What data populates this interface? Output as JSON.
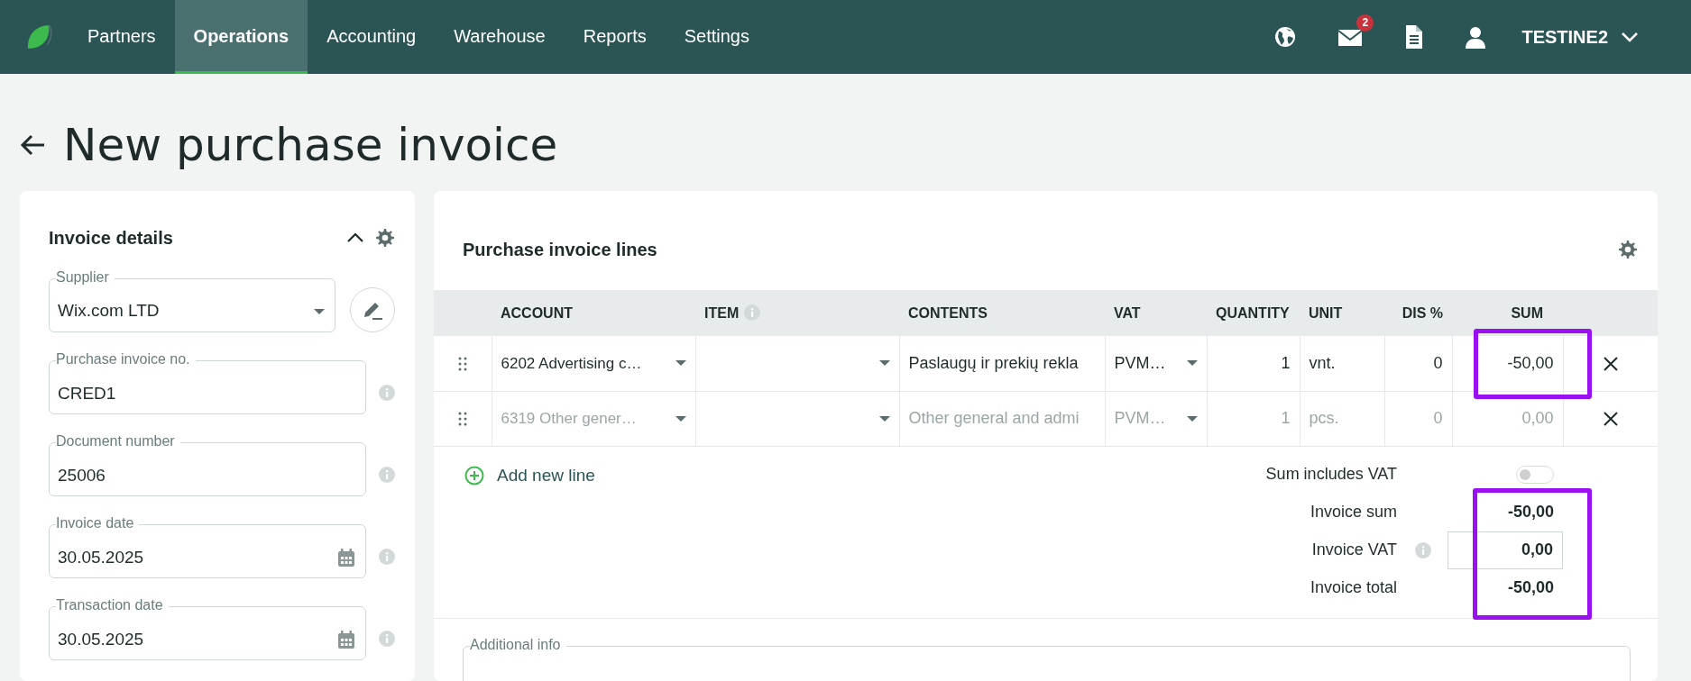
{
  "navbar": {
    "menu": [
      {
        "label": "Partners",
        "selected": false
      },
      {
        "label": "Operations",
        "selected": true
      },
      {
        "label": "Accounting",
        "selected": false
      },
      {
        "label": "Warehouse",
        "selected": false
      },
      {
        "label": "Reports",
        "selected": false
      },
      {
        "label": "Settings",
        "selected": false
      }
    ],
    "notification_count": "2",
    "user": "TESTINE2"
  },
  "page": {
    "title": "New purchase invoice"
  },
  "invoice_details": {
    "title": "Invoice details",
    "expanded": true,
    "fields": [
      {
        "kind": "select",
        "label": "Supplier",
        "value": "Wix.com LTD",
        "info": false
      },
      {
        "kind": "text",
        "label": "Purchase invoice no.",
        "value": "CRED1",
        "info": true
      },
      {
        "kind": "text",
        "label": "Document number",
        "value": "25006",
        "info": true
      },
      {
        "kind": "date",
        "label": "Invoice date",
        "value": "30.05.2025",
        "info": true
      },
      {
        "kind": "date",
        "label": "Transaction date",
        "value": "30.05.2025",
        "info": true
      }
    ]
  },
  "lines": {
    "title": "Purchase invoice lines",
    "columns": [
      {
        "label": "ACCOUNT",
        "info": false
      },
      {
        "label": "ITEM",
        "info": true
      },
      {
        "label": "CONTENTS",
        "info": false
      },
      {
        "label": "VAT",
        "info": false
      },
      {
        "label": "QUANTITY",
        "info": false
      },
      {
        "label": "UNIT",
        "info": false
      },
      {
        "label": "DIS %",
        "info": false
      },
      {
        "label": "SUM",
        "info": false
      }
    ],
    "rows": [
      {
        "account": "6202 Advertising c…",
        "contents": "Paslaugų ir prekių rekla",
        "vat": "PVM…",
        "quantity": "1",
        "unit": "vnt.",
        "discount": "0",
        "sum": "-50,00",
        "placeholder": false,
        "highlighted": true
      },
      {
        "account": "6319 Other gener…",
        "contents": "Other general and admi",
        "vat": "PVM…",
        "quantity": "1",
        "unit": "pcs.",
        "discount": "0",
        "sum": "0,00",
        "placeholder": true,
        "highlighted": false
      }
    ],
    "add_line": "Add new line",
    "sum_includes_vat": {
      "label": "Sum includes VAT",
      "on": false
    },
    "totals": [
      {
        "kind": "text",
        "label": "Invoice sum",
        "value": "-50,00",
        "info": false
      },
      {
        "kind": "field",
        "label": "Invoice VAT",
        "value": "0,00",
        "info": true
      },
      {
        "kind": "text",
        "label": "Invoice total",
        "value": "-50,00",
        "info": false
      }
    ],
    "totals_highlighted": true
  },
  "additional_info": {
    "label": "Additional info"
  }
}
